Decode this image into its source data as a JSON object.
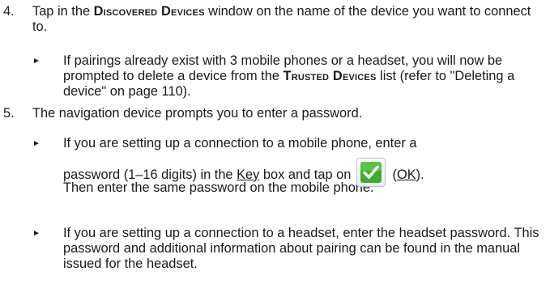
{
  "steps": [
    {
      "number": "4.",
      "text_before": "Tap in the ",
      "highlight": "Discovered Devices",
      "text_after": " window on the name of the device you want to connect to.",
      "bullets": [
        {
          "text_before": "If pairings already exist with 3 mobile phones or a headset, you will now be prompted to delete a device from the ",
          "highlight": "Trusted Devices",
          "text_after": " list (refer to \"Deleting a device\" on page 110)."
        }
      ]
    },
    {
      "number": "5.",
      "text": "The navigation device prompts you to enter a password.",
      "bullets": [
        {
          "line1": "If you are setting up a connection to a mobile phone, enter a",
          "line2_before": "password (1–16 digits) in the ",
          "key_label": "Key",
          "line2_middle": " box and tap on",
          "ok_icon": "ok-checkmark-icon",
          "ok_label": "OK",
          "line3": "Then enter the same password on the mobile phone."
        },
        {
          "text": "If you are setting up a connection to a headset, enter the headset password. This password and additional information about pairing can be found in the manual issued for the headset."
        }
      ]
    }
  ],
  "colors": {
    "text": "#1a1a1a",
    "ok_icon_check": "#3cae2a"
  }
}
